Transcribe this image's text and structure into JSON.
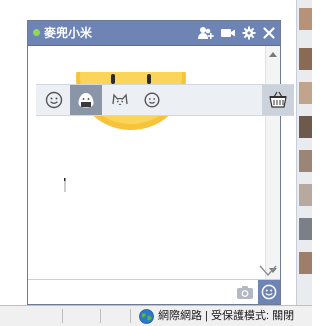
{
  "chat": {
    "title": "麥兜小米",
    "presence": "online",
    "input_value": "",
    "input_placeholder": ""
  },
  "header_icons": [
    "add-friend-icon",
    "video-call-icon",
    "settings-gear-icon",
    "close-icon"
  ],
  "sticker_tabs": [
    {
      "name": "smiley-tab",
      "active": false
    },
    {
      "name": "rice-ball-sticker-tab",
      "active": true
    },
    {
      "name": "cat-sticker-tab",
      "active": false
    },
    {
      "name": "face-sticker-tab",
      "active": false
    }
  ],
  "status": {
    "zone_text": "網際網路 | 受保護模式: 關閉"
  },
  "colors": {
    "header_bg": "#6d84b4",
    "presence_green": "#8ddb55",
    "active_tab_bg": "#8b95a8",
    "sticker_yellow": "#f7c33a"
  }
}
